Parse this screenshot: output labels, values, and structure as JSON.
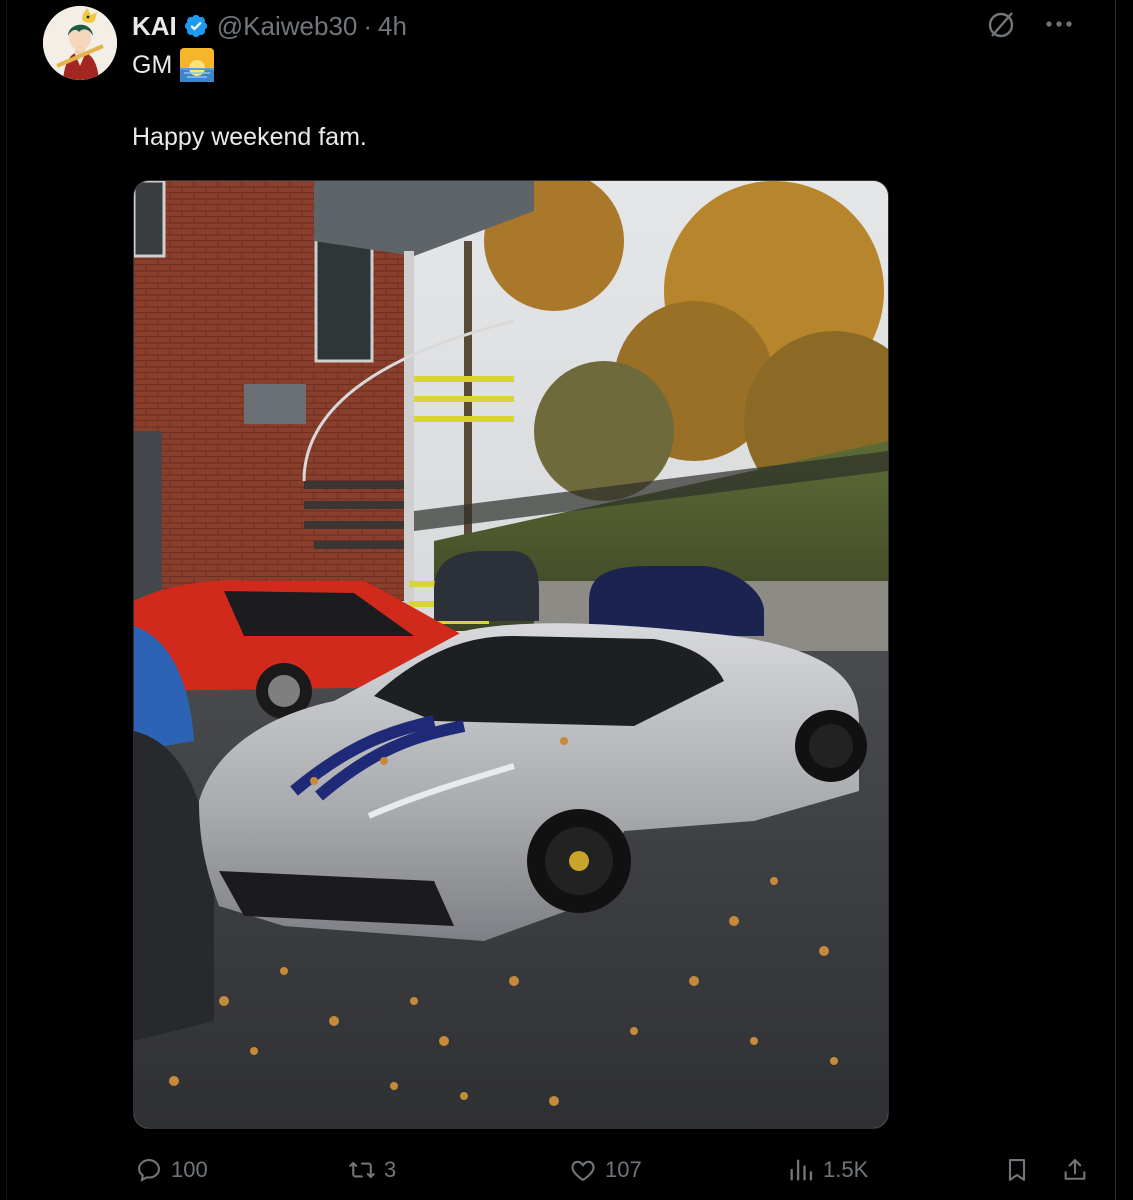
{
  "post": {
    "author_name": "KAI",
    "handle": "@Kaiweb30",
    "separator": "·",
    "time": "4h",
    "line1": "GM",
    "line2": "Happy weekend fam.",
    "icons": {
      "verified": "verified-badge-icon",
      "emoji": "sunrise-emoji-icon",
      "grok": "grok-icon",
      "more": "more-options-icon"
    }
  },
  "actions": {
    "replies": "100",
    "reposts": "3",
    "likes": "107",
    "views": "1.5K",
    "icons": [
      "reply-icon",
      "repost-icon",
      "like-icon",
      "views-icon",
      "bookmark-icon",
      "share-icon"
    ]
  },
  "colors": {
    "background": "#000000",
    "text": "#e7e9ea",
    "muted": "#71767b",
    "verified": "#1d9bf0"
  }
}
